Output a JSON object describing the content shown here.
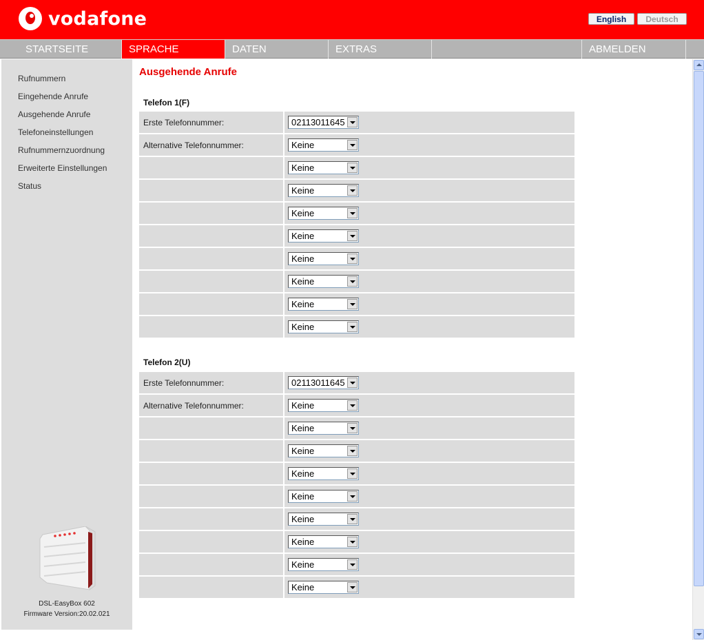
{
  "brand": {
    "name": "vodafone"
  },
  "language": {
    "english": "English",
    "deutsch": "Deutsch"
  },
  "nav": [
    {
      "label": "STARTSEITE"
    },
    {
      "label": "SPRACHE"
    },
    {
      "label": "DATEN"
    },
    {
      "label": "EXTRAS"
    },
    {
      "label": ""
    },
    {
      "label": "ABMELDEN"
    }
  ],
  "sidebar": {
    "items": [
      "Rufnummern",
      "Eingehende Anrufe",
      "Ausgehende Anrufe",
      "Telefoneinstellungen",
      "Rufnummernzuordnung",
      "Erweiterte Einstellungen",
      "Status"
    ],
    "device_name": "DSL-EasyBox 602",
    "firmware": "Firmware Version:20.02.021"
  },
  "page_title": "Ausgehende Anrufe",
  "phones": [
    {
      "title": "Telefon 1(F)",
      "rows": [
        {
          "label": "Erste Telefonnummer:",
          "value": "02113011645"
        },
        {
          "label": "Alternative Telefonnummer:",
          "value": "Keine"
        },
        {
          "label": "",
          "value": "Keine"
        },
        {
          "label": "",
          "value": "Keine"
        },
        {
          "label": "",
          "value": "Keine"
        },
        {
          "label": "",
          "value": "Keine"
        },
        {
          "label": "",
          "value": "Keine"
        },
        {
          "label": "",
          "value": "Keine"
        },
        {
          "label": "",
          "value": "Keine"
        },
        {
          "label": "",
          "value": "Keine"
        }
      ]
    },
    {
      "title": "Telefon 2(U)",
      "rows": [
        {
          "label": "Erste Telefonnummer:",
          "value": "02113011645"
        },
        {
          "label": "Alternative Telefonnummer:",
          "value": "Keine"
        },
        {
          "label": "",
          "value": "Keine"
        },
        {
          "label": "",
          "value": "Keine"
        },
        {
          "label": "",
          "value": "Keine"
        },
        {
          "label": "",
          "value": "Keine"
        },
        {
          "label": "",
          "value": "Keine"
        },
        {
          "label": "",
          "value": "Keine"
        },
        {
          "label": "",
          "value": "Keine"
        },
        {
          "label": "",
          "value": "Keine"
        }
      ]
    }
  ],
  "colors": {
    "brand_red": "#ff0000",
    "nav_gray": "#b4b4b4",
    "sidebar_gray": "#dddddd"
  }
}
